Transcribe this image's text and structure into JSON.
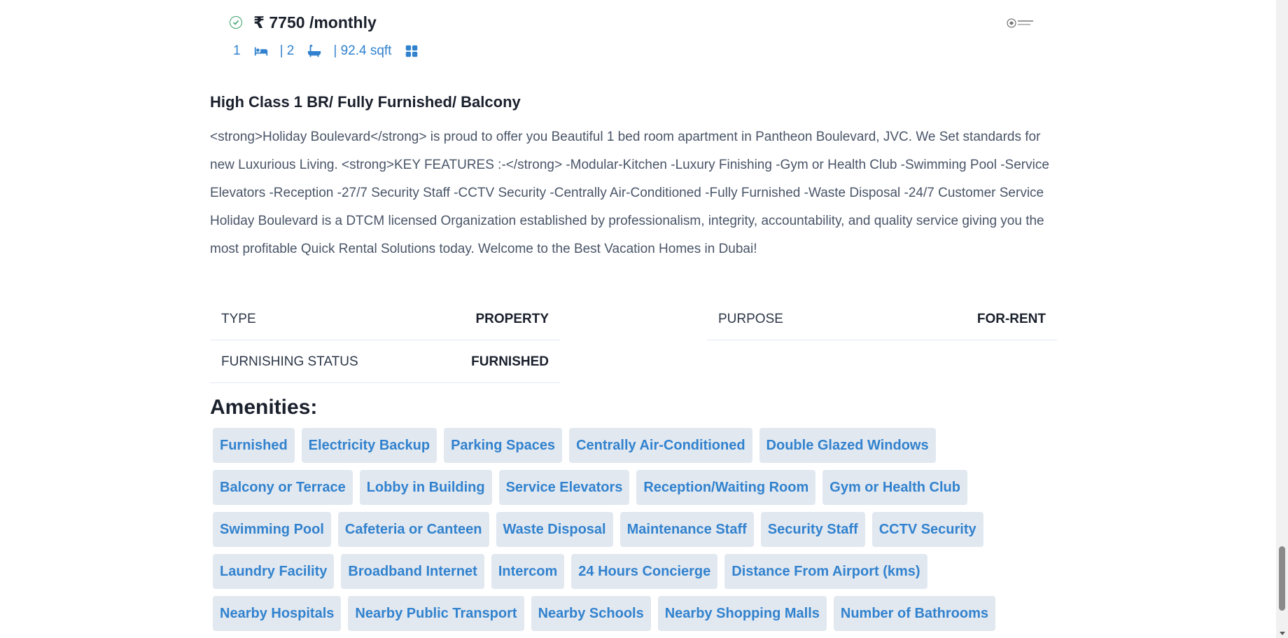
{
  "listing": {
    "price": "₹ 7750 /monthly",
    "rooms": "1",
    "baths": "| 2",
    "area": "| 92.4 sqft",
    "title": "High Class 1 BR/ Fully Furnished/ Balcony",
    "description": "<strong>Holiday Boulevard</strong> is proud to offer you Beautiful 1 bed room apartment in Pantheon Boulevard, JVC. We Set standards for new Luxurious Living. <strong>KEY FEATURES :-</strong> -Modular-Kitchen -Luxury Finishing  -Gym or Health Club -Swimming Pool -Service Elevators -Reception -27/7 Security Staff -CCTV Security -Centrally Air-Conditioned -Fully Furnished -Waste Disposal -24/7 Customer Service Holiday Boulevard is a DTCM licensed Organization established by professionalism, integrity, accountability, and quality service giving you the most profitable Quick Rental Solutions today.   Welcome to the Best Vacation Homes in Dubai!"
  },
  "details": {
    "type_label": "TYPE",
    "type_value": "PROPERTY",
    "purpose_label": "PURPOSE",
    "purpose_value": "FOR-RENT",
    "furnishing_label": "FURNISHING STATUS",
    "furnishing_value": "FURNISHED"
  },
  "amenities": {
    "title": "Amenities:",
    "items": [
      "Furnished",
      "Electricity Backup",
      "Parking Spaces",
      "Centrally Air-Conditioned",
      "Double Glazed Windows",
      "Balcony or Terrace",
      "Lobby in Building",
      "Service Elevators",
      "Reception/Waiting Room",
      "Gym or Health Club",
      "Swimming Pool",
      "Cafeteria or Canteen",
      "Waste Disposal",
      "Maintenance Staff",
      "Security Staff",
      "CCTV Security",
      "Laundry Facility",
      "Broadband Internet",
      "Intercom",
      "24 Hours Concierge",
      "Distance From Airport (kms)",
      "Nearby Hospitals",
      "Nearby Public Transport",
      "Nearby Schools",
      "Nearby Shopping Malls",
      "Number of Bathrooms"
    ]
  },
  "icons": {
    "verified": "check-circle-icon",
    "bed": "bed-icon",
    "bath": "bath-icon",
    "area": "grid-icon",
    "logo": "agency-logo"
  },
  "colors": {
    "accent": "#3182ce",
    "chip_bg": "#e2e8f0",
    "verified": "#38a169"
  }
}
